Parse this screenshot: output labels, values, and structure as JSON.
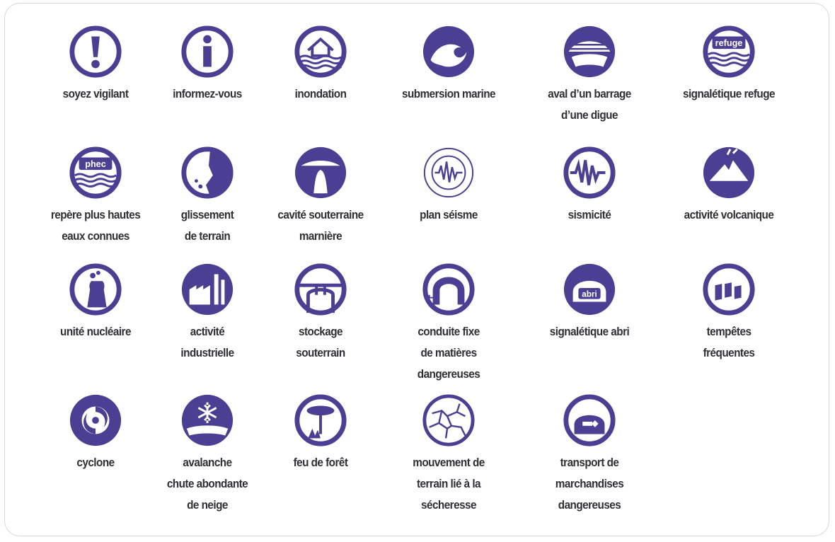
{
  "icon_color": "#4b3f93",
  "items": [
    {
      "label": "soyez vigilant",
      "icon": "exclamation-icon"
    },
    {
      "label": "informez-vous",
      "icon": "info-icon"
    },
    {
      "label": "inondation",
      "icon": "flood-house-icon"
    },
    {
      "label": "submersion marine",
      "icon": "wave-icon"
    },
    {
      "label": "aval d’un barrage\nd’une digue",
      "icon": "dam-icon"
    },
    {
      "label": "signalétique refuge",
      "icon": "refuge-sign-icon",
      "badge": "refuge"
    },
    {
      "label": "repère plus hautes\neaux connues",
      "icon": "phec-icon",
      "badge": "phec"
    },
    {
      "label": "glissement\nde terrain",
      "icon": "landslide-icon"
    },
    {
      "label": "cavité souterraine\nmarnière",
      "icon": "cavity-icon"
    },
    {
      "label": "plan séisme",
      "icon": "seismic-plan-icon"
    },
    {
      "label": "sismicité",
      "icon": "seismicity-icon"
    },
    {
      "label": "activité volcanique",
      "icon": "volcano-icon"
    },
    {
      "label": "unité nucléaire",
      "icon": "nuclear-plant-icon"
    },
    {
      "label": "activité\nindustrielle",
      "icon": "factory-icon"
    },
    {
      "label": "stockage\nsouterrain",
      "icon": "underground-storage-icon"
    },
    {
      "label": "conduite fixe\nde matières\ndangereuses",
      "icon": "pipeline-icon"
    },
    {
      "label": "signalétique abri",
      "icon": "shelter-sign-icon",
      "badge": "abri"
    },
    {
      "label": "tempêtes\nfréquentes",
      "icon": "storm-icon"
    },
    {
      "label": "cyclone",
      "icon": "cyclone-icon"
    },
    {
      "label": "avalanche\nchute abondante\nde neige",
      "icon": "avalanche-snowflake-icon"
    },
    {
      "label": "feu de forêt",
      "icon": "forest-fire-icon"
    },
    {
      "label": "mouvement de\nterrain lié à la\nsécheresse",
      "icon": "drought-cracks-icon"
    },
    {
      "label": "transport de\nmarchandises\ndangereuses",
      "icon": "hazmat-transport-icon"
    }
  ]
}
